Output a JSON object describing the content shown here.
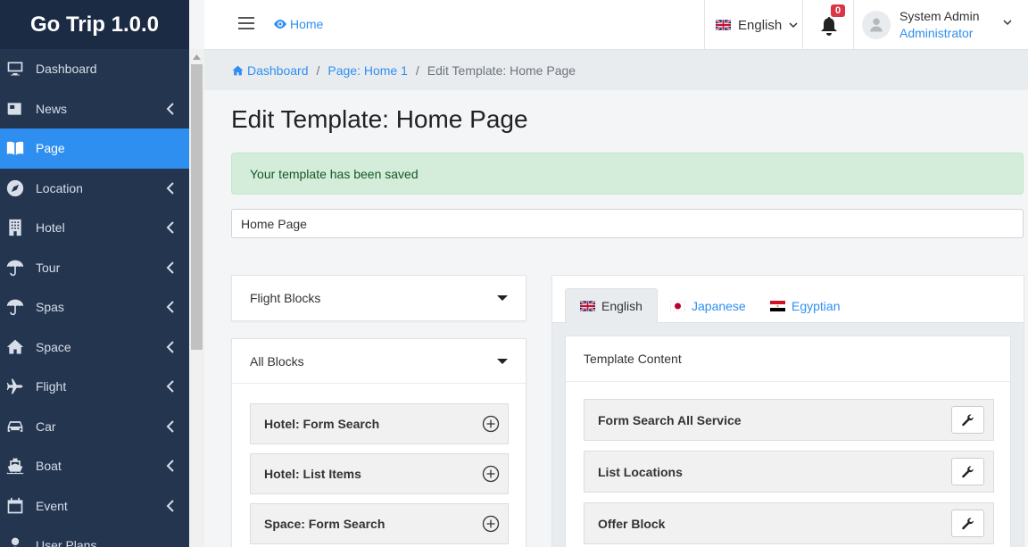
{
  "app": {
    "brand": "Go Trip 1.0.0"
  },
  "sidebar": {
    "items": [
      {
        "label": "Dashboard",
        "icon": "monitor-icon",
        "has_submenu": false,
        "active": false
      },
      {
        "label": "News",
        "icon": "newspaper-icon",
        "has_submenu": true,
        "active": false
      },
      {
        "label": "Page",
        "icon": "book-icon",
        "has_submenu": false,
        "active": true
      },
      {
        "label": "Location",
        "icon": "compass-icon",
        "has_submenu": true,
        "active": false
      },
      {
        "label": "Hotel",
        "icon": "building-icon",
        "has_submenu": true,
        "active": false
      },
      {
        "label": "Tour",
        "icon": "umbrella-icon",
        "has_submenu": true,
        "active": false
      },
      {
        "label": "Spas",
        "icon": "umbrella-icon",
        "has_submenu": true,
        "active": false
      },
      {
        "label": "Space",
        "icon": "home-icon",
        "has_submenu": true,
        "active": false
      },
      {
        "label": "Flight",
        "icon": "plane-icon",
        "has_submenu": true,
        "active": false
      },
      {
        "label": "Car",
        "icon": "car-icon",
        "has_submenu": true,
        "active": false
      },
      {
        "label": "Boat",
        "icon": "ship-icon",
        "has_submenu": true,
        "active": false
      },
      {
        "label": "Event",
        "icon": "calendar-icon",
        "has_submenu": true,
        "active": false
      },
      {
        "label": "User Plans",
        "icon": "user-icon",
        "has_submenu": false,
        "active": false
      }
    ]
  },
  "topbar": {
    "home_label": "Home",
    "language": "English",
    "notifications_count": "0",
    "user_name": "System Admin",
    "user_role": "Administrator"
  },
  "breadcrumb": {
    "items": [
      "Dashboard",
      "Page: Home 1",
      "Edit Template: Home Page"
    ]
  },
  "page": {
    "title": "Edit Template: Home Page",
    "alert": "Your template has been saved",
    "template_name": "Home Page"
  },
  "left": {
    "flight_blocks_label": "Flight Blocks",
    "all_blocks_label": "All Blocks",
    "blocks": [
      "Hotel: Form Search",
      "Hotel: List Items",
      "Space: Form Search"
    ]
  },
  "right": {
    "tabs": [
      "English",
      "Japanese",
      "Egyptian"
    ],
    "content_header": "Template Content",
    "items": [
      "Form Search All Service",
      "List Locations",
      "Offer Block"
    ]
  },
  "colors": {
    "sidebar_bg": "#243550",
    "accent": "#2f8ff0",
    "alert_bg": "#d4edda",
    "badge": "#dc3545"
  }
}
